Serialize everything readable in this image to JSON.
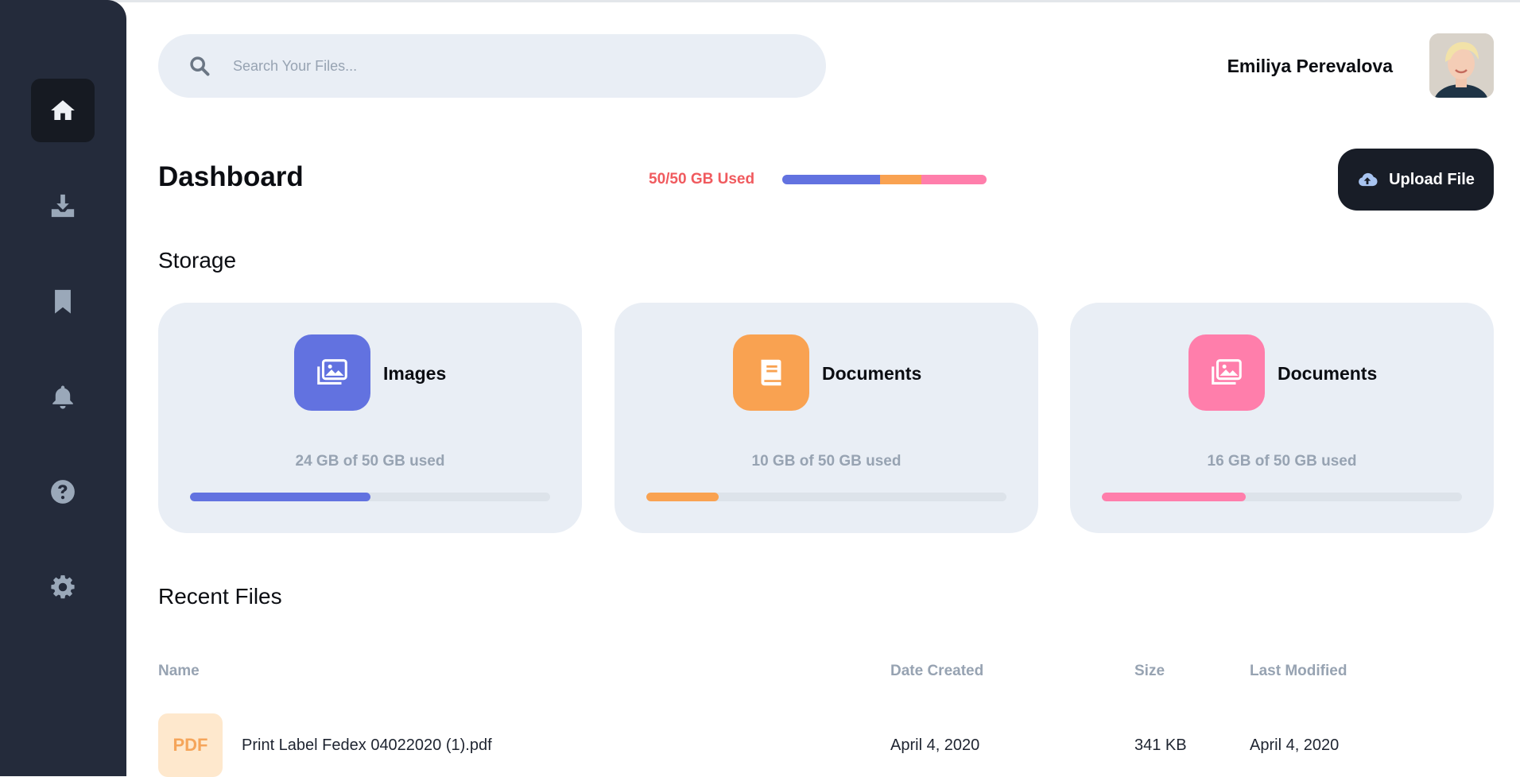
{
  "colors": {
    "sidebar": "#242b3b",
    "images": "#6272e0",
    "documents_orange": "#f9a251",
    "documents_pink": "#ff7eab",
    "danger": "#f05a5e"
  },
  "sidebar": {
    "items": [
      {
        "name": "home",
        "icon": "home-icon",
        "active": true
      },
      {
        "name": "downloads",
        "icon": "download-icon",
        "active": false
      },
      {
        "name": "bookmarks",
        "icon": "bookmark-icon",
        "active": false
      },
      {
        "name": "notifications",
        "icon": "bell-icon",
        "active": false
      },
      {
        "name": "help",
        "icon": "question-circle-icon",
        "active": false
      },
      {
        "name": "settings",
        "icon": "gear-icon",
        "active": false
      }
    ]
  },
  "search": {
    "placeholder": "Search Your Files...",
    "icon": "search-icon"
  },
  "user": {
    "name": "Emiliya Perevalova",
    "avatar_icon": "user-avatar"
  },
  "header": {
    "title": "Dashboard",
    "usage_label": "50/50 GB Used",
    "usage_segments": [
      {
        "category": "Images",
        "value_gb": 24,
        "color": "#6272e0"
      },
      {
        "category": "Documents",
        "value_gb": 10,
        "color": "#f9a251"
      },
      {
        "category": "Documents",
        "value_gb": 16,
        "color": "#ff7eab"
      }
    ],
    "upload_label": "Upload File",
    "upload_icon": "cloud-upload-icon"
  },
  "storage": {
    "title": "Storage",
    "cards": [
      {
        "name": "Images",
        "usage_text": "24 GB of 50 GB used",
        "fraction": 0.5,
        "color": "#6272e0",
        "icon": "images-icon"
      },
      {
        "name": "Documents",
        "usage_text": "10 GB of 50 GB used",
        "fraction": 0.2,
        "color": "#f9a251",
        "icon": "book-icon"
      },
      {
        "name": "Documents",
        "usage_text": "16 GB of 50 GB used",
        "fraction": 0.4,
        "color": "#ff7eab",
        "icon": "images-icon"
      }
    ]
  },
  "recent": {
    "title": "Recent Files",
    "columns": [
      "Name",
      "Date Created",
      "Size",
      "Last Modified"
    ],
    "rows": [
      {
        "badge": "PDF",
        "name": "Print Label Fedex 04022020 (1).pdf",
        "created": "April 4, 2020",
        "size": "341 KB",
        "modified": "April 4, 2020"
      }
    ]
  }
}
